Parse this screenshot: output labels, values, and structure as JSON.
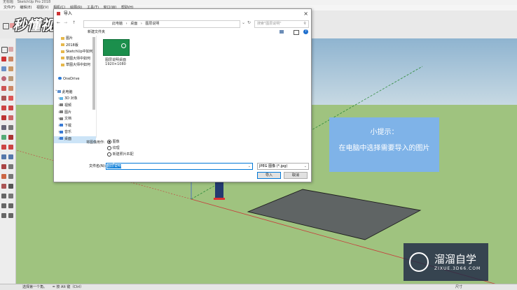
{
  "app": {
    "title_left": "无标题",
    "title_right": "SketchUp Pro 2018",
    "menu": [
      "文件(F)",
      "编辑(E)",
      "视图(V)",
      "相机(C)",
      "绘图(R)",
      "工具(T)",
      "窗口(W)",
      "帮助(H)"
    ],
    "status_left": "选择第一个角。",
    "status_mid": "= 按 Alt 键（Ctrl）",
    "status_right": "尺寸",
    "logo_text": "秒懂视频"
  },
  "dialog": {
    "title": "导入",
    "close": "×",
    "breadcrumb": [
      "此电脑",
      "桌面",
      "图层说明"
    ],
    "search_placeholder": "搜索\"图层说明\"",
    "toolbar_label": "新建文件夹",
    "tree": [
      {
        "label": "图片",
        "icon_color": "#e6b84c"
      },
      {
        "label": "2018版",
        "icon_color": "#e6b84c"
      },
      {
        "label": "SketchUp中如何",
        "icon_color": "#e6b84c"
      },
      {
        "label": "草图大师中如何",
        "icon_color": "#e6b84c"
      },
      {
        "label": "草图大师中如何",
        "icon_color": "#e6b84c"
      },
      {
        "label": "",
        "icon_color": "#ffffff"
      },
      {
        "label": "OneDrive",
        "icon_color": "#2f7bd6"
      },
      {
        "label": "",
        "icon_color": "#ffffff"
      },
      {
        "label": "此电脑",
        "icon_color": "#5b8fd0"
      },
      {
        "label": "3D 对象",
        "icon_color": "#5fb4e6"
      },
      {
        "label": "视频",
        "icon_color": "#7b7b7b"
      },
      {
        "label": "图片",
        "icon_color": "#7b7b7b"
      },
      {
        "label": "文档",
        "icon_color": "#7b7b7b"
      },
      {
        "label": "下载",
        "icon_color": "#3a7bd5"
      },
      {
        "label": "音乐",
        "icon_color": "#3a7bd5"
      },
      {
        "label": "桌面",
        "icon_color": "#3a7bd5"
      }
    ],
    "file": {
      "name": "图层说明桌面",
      "size": "1920×1080"
    },
    "options_label": "将图像用作:",
    "options": [
      "图像",
      "纹理",
      "新建照片匹配"
    ],
    "filename_label": "文件名(N):",
    "filename_value": "图层说明",
    "filetype_value": "JPEG 图像 (*.jpg)",
    "import_button": "导入",
    "cancel_button": "取消"
  },
  "tip": {
    "title": "小提示：",
    "body": "在电脑中选择需要导入的图片"
  },
  "watermark": {
    "brand": "溜溜自学",
    "url": "ZIXUE.3D66.COM"
  },
  "colors": {
    "sky": "#9fc0d6",
    "ground": "#9fc37f",
    "tip_bg": "#7fb3e8",
    "accent": "#0078d7"
  }
}
